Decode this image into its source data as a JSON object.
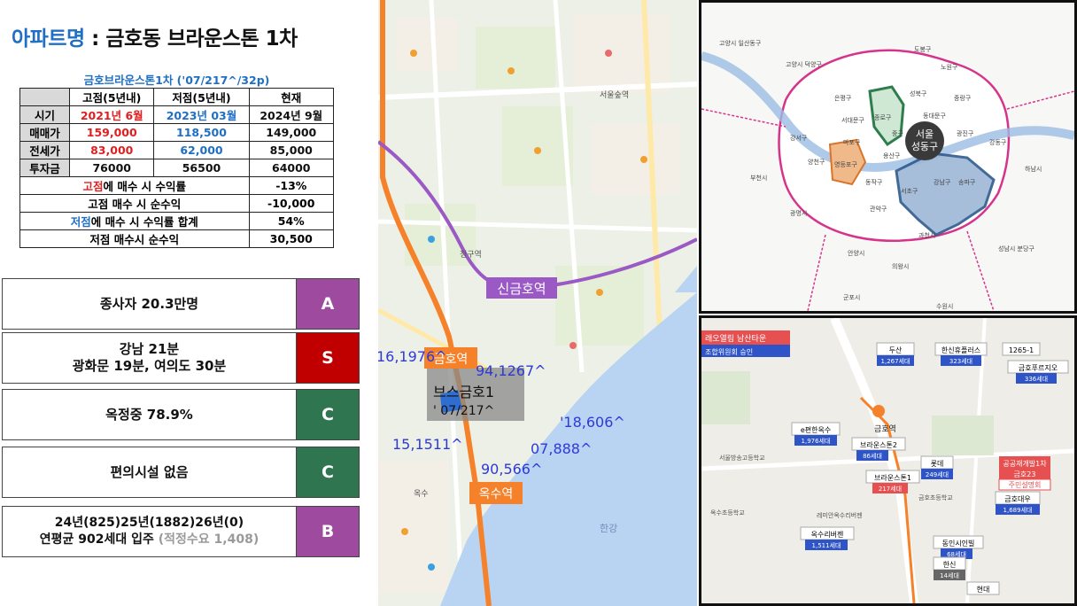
{
  "header": {
    "label": "아파트명",
    "separator": " : ",
    "name": "금호동 브라운스톤 1차"
  },
  "price_table": {
    "caption": "금호브라운스톤1차 ('07/217^/32p)",
    "col_high": "고점(5년내)",
    "col_low": "저점(5년내)",
    "col_now": "현재",
    "rows": [
      {
        "label": "시기",
        "high": "2021년 6월",
        "low": "2023년 03월",
        "now": "2024년 9월"
      },
      {
        "label": "매매가",
        "high": "159,000",
        "low": "118,500",
        "now": "149,000"
      },
      {
        "label": "전세가",
        "high": "83,000",
        "low": "62,000",
        "now": "85,000"
      },
      {
        "label": "투자금",
        "high": "76000",
        "low": "56500",
        "now": "64000"
      }
    ],
    "summary": [
      {
        "prefix": "고점",
        "rest": "에 매수 시 수익률",
        "value": "-13%"
      },
      {
        "prefix": "",
        "rest": "고점 매수 시 순수익",
        "value": "-10,000"
      },
      {
        "prefix": "저점",
        "rest": "에 매수 시 수익률 합계",
        "value": "54%"
      },
      {
        "prefix": "",
        "rest": "저점 매수시 순수익",
        "value": "30,500"
      }
    ]
  },
  "grades": [
    {
      "line1": "종사자 20.3만명",
      "line2": "",
      "grade": "A",
      "color": "#9e4a9e"
    },
    {
      "line1": "강남 21분",
      "line2": "광화문 19분, 여의도 30분",
      "grade": "S",
      "color": "#c00000"
    },
    {
      "line1": "옥정중 78.9%",
      "line2": "",
      "grade": "C",
      "color": "#2e7550"
    },
    {
      "line1": "편의시설 없음",
      "line2": "",
      "grade": "C",
      "color": "#2e7550"
    },
    {
      "line1": "24년(825)25년(1882)26년(0)",
      "line2": "연평균 902세대 입주",
      "note": "(적정수요 1,408)",
      "grade": "B",
      "color": "#9e4a9e"
    }
  ],
  "center_map": {
    "stations": [
      {
        "label": "신금호역",
        "color": "#9b59c5"
      },
      {
        "label": "금호역",
        "color": "#f5822a"
      },
      {
        "label": "옥수역",
        "color": "#f5822a"
      }
    ],
    "target_label_line1": "브스금호1",
    "target_label_line2": "' 07/217^",
    "price_labels": [
      "16,1976^",
      "94,1267^",
      "15,1511^",
      "'18,606^",
      "07,888^",
      "90,566^"
    ],
    "place_labels": [
      "청구역",
      "서울숲역",
      "옥수",
      "한강"
    ]
  },
  "top_right_map": {
    "district_label_1": "서울",
    "district_label_2": "성동구",
    "place_labels": [
      "고양시 일산동구",
      "고양시 덕양구",
      "노원구",
      "도봉구",
      "은평구",
      "성북구",
      "중랑구",
      "종로구",
      "동대문구",
      "서대문구",
      "중구",
      "광진구",
      "강동구",
      "마포구",
      "용산구",
      "강서구",
      "양천구",
      "영등포구",
      "동작구",
      "서초구",
      "강남구",
      "송파구",
      "관악구",
      "부천시",
      "광명시",
      "과천시",
      "하남시",
      "성남시 분당구",
      "안양시",
      "의왕시",
      "군포시",
      "수원시"
    ]
  },
  "bottom_right_map": {
    "chips": [
      {
        "name": "두산",
        "units": "1,267세대"
      },
      {
        "name": "한신휴플러스",
        "units": "323세대"
      },
      {
        "name": "1265-1",
        "units": ""
      },
      {
        "name": "금호푸르지오",
        "units": "336세대"
      },
      {
        "name": "e편한옥수",
        "units": "1,976세대"
      },
      {
        "name": "브라운스톤2",
        "units": "86세대"
      },
      {
        "name": "롯데",
        "units": "249세대"
      },
      {
        "name": "브라운스톤1",
        "units": "217세대"
      },
      {
        "name": "금호대우",
        "units": "1,689세대"
      },
      {
        "name": "옥수리버젠",
        "units": "1,511세대"
      },
      {
        "name": "동인시인빌",
        "units": "68세대"
      },
      {
        "name": "한신",
        "units": "14세대"
      },
      {
        "name": "현대",
        "units": ""
      }
    ],
    "banner_title": "래오열림 남산타운",
    "banner_sub": "조합위원회 승인",
    "redev_title": "공공재개발1차",
    "redev_name": "금호23",
    "redev_sub": "주민설명회",
    "station": "금호역",
    "places": [
      "서울방송고등학교",
      "옥수초등학교",
      "금호초등학교",
      "레미안옥수리버젠"
    ]
  }
}
